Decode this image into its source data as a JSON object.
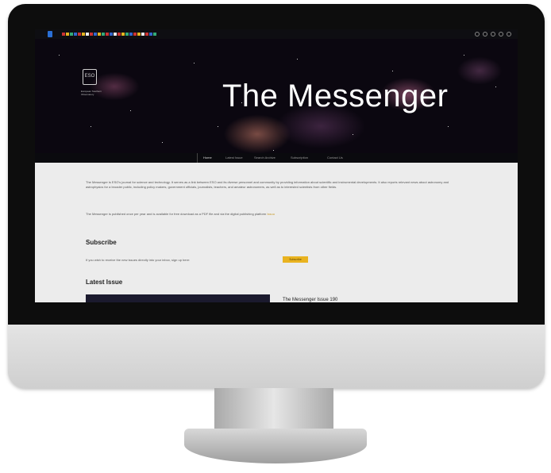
{
  "site": {
    "title": "The Messenger",
    "eso_logo_glyph": "ESO",
    "eso_org": "European Southern Observatory"
  },
  "nav": {
    "items": [
      "Home",
      "Latest Issue",
      "Search Archive",
      "Subscription",
      "Contact Us"
    ]
  },
  "intro": {
    "paragraph1": "The Messenger is ESO's journal for science and technology. It serves as a link between ESO and its diverse personnel and community by providing information about scientific and instrumental developments. It also reports relevant news about astronomy and astrophysics for a broader public, including policy makers, government officials, journalists, teachers, and amateur astronomers, as well as to interested scientists from other fields.",
    "paragraph2": "The Messenger is published once per year and is available for free download as a PDF file and via the digital publishing platform",
    "paragraph2_link": "Issuu"
  },
  "subscribe": {
    "heading": "Subscribe",
    "text": "If you wish to receive the new issues directly into your inbox, sign up here:",
    "button_label": "Subscribe"
  },
  "latest": {
    "heading": "Latest Issue",
    "title": "The Messenger Issue 190"
  },
  "colors": {
    "accent": "#e9b320",
    "screen_bg": "#ececec",
    "header_bg": "#0b0710"
  }
}
